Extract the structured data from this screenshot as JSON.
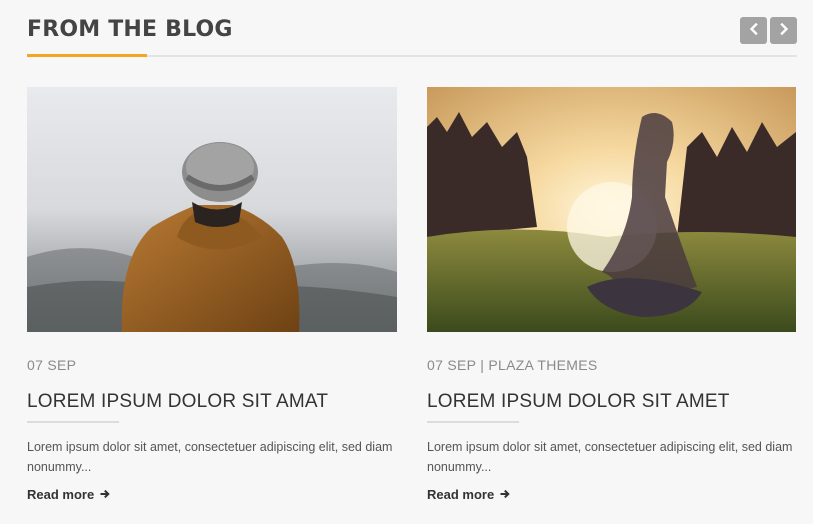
{
  "section": {
    "title": "FROM THE BLOG",
    "accent_color": "#f3a623",
    "prev_icon": "chevron-left-icon",
    "next_icon": "chevron-right-icon"
  },
  "posts": [
    {
      "image": "man-in-beanie-foggy-hills-photo",
      "meta": "07 SEP",
      "title": "LOREM IPSUM DOLOR SIT AMAT",
      "excerpt": "Lorem ipsum dolor sit amet, consectetuer adipiscing elit, sed diam nonummy...",
      "read_more": "Read more",
      "read_more_icon": "arrow-right-icon"
    },
    {
      "image": "girl-in-sunlit-field-photo",
      "meta": "07 SEP | PLAZA THEMES",
      "title": "LOREM IPSUM DOLOR SIT AMET",
      "excerpt": "Lorem ipsum dolor sit amet, consectetuer adipiscing elit, sed diam nonummy...",
      "read_more": "Read more",
      "read_more_icon": "arrow-right-icon"
    }
  ]
}
